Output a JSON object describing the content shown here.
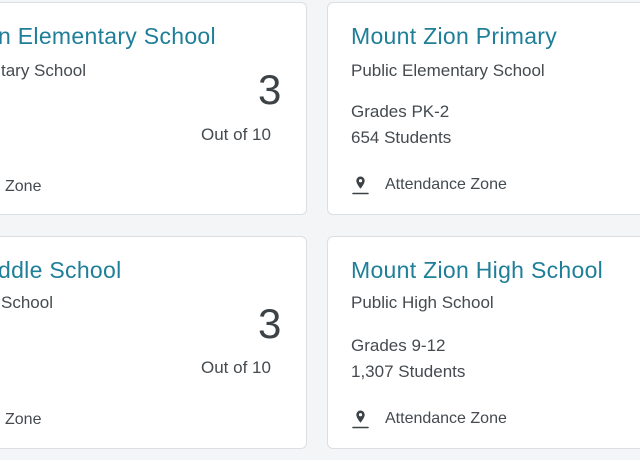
{
  "cards": [
    {
      "title": "n Elementary School",
      "subtitle": "tary School",
      "rating": "3",
      "rating_suffix": "Out of 10",
      "zone_label": "Zone"
    },
    {
      "title": "Mount Zion Primary",
      "subtitle": "Public Elementary School",
      "grades": "Grades PK-2",
      "students": "654 Students",
      "zone_label": "Attendance Zone"
    },
    {
      "title": "ddle School",
      "subtitle": "School",
      "rating": "3",
      "rating_suffix": "Out of 10",
      "zone_label": "Zone"
    },
    {
      "title": "Mount Zion High School",
      "subtitle": "Public High School",
      "grades": "Grades 9-12",
      "students": "1,307 Students",
      "zone_label": "Attendance Zone"
    }
  ],
  "icons": {
    "zone": "map-pin-icon"
  },
  "colors": {
    "title": "#1f7e98",
    "text": "#444a4f",
    "border": "#dcdfe2"
  }
}
